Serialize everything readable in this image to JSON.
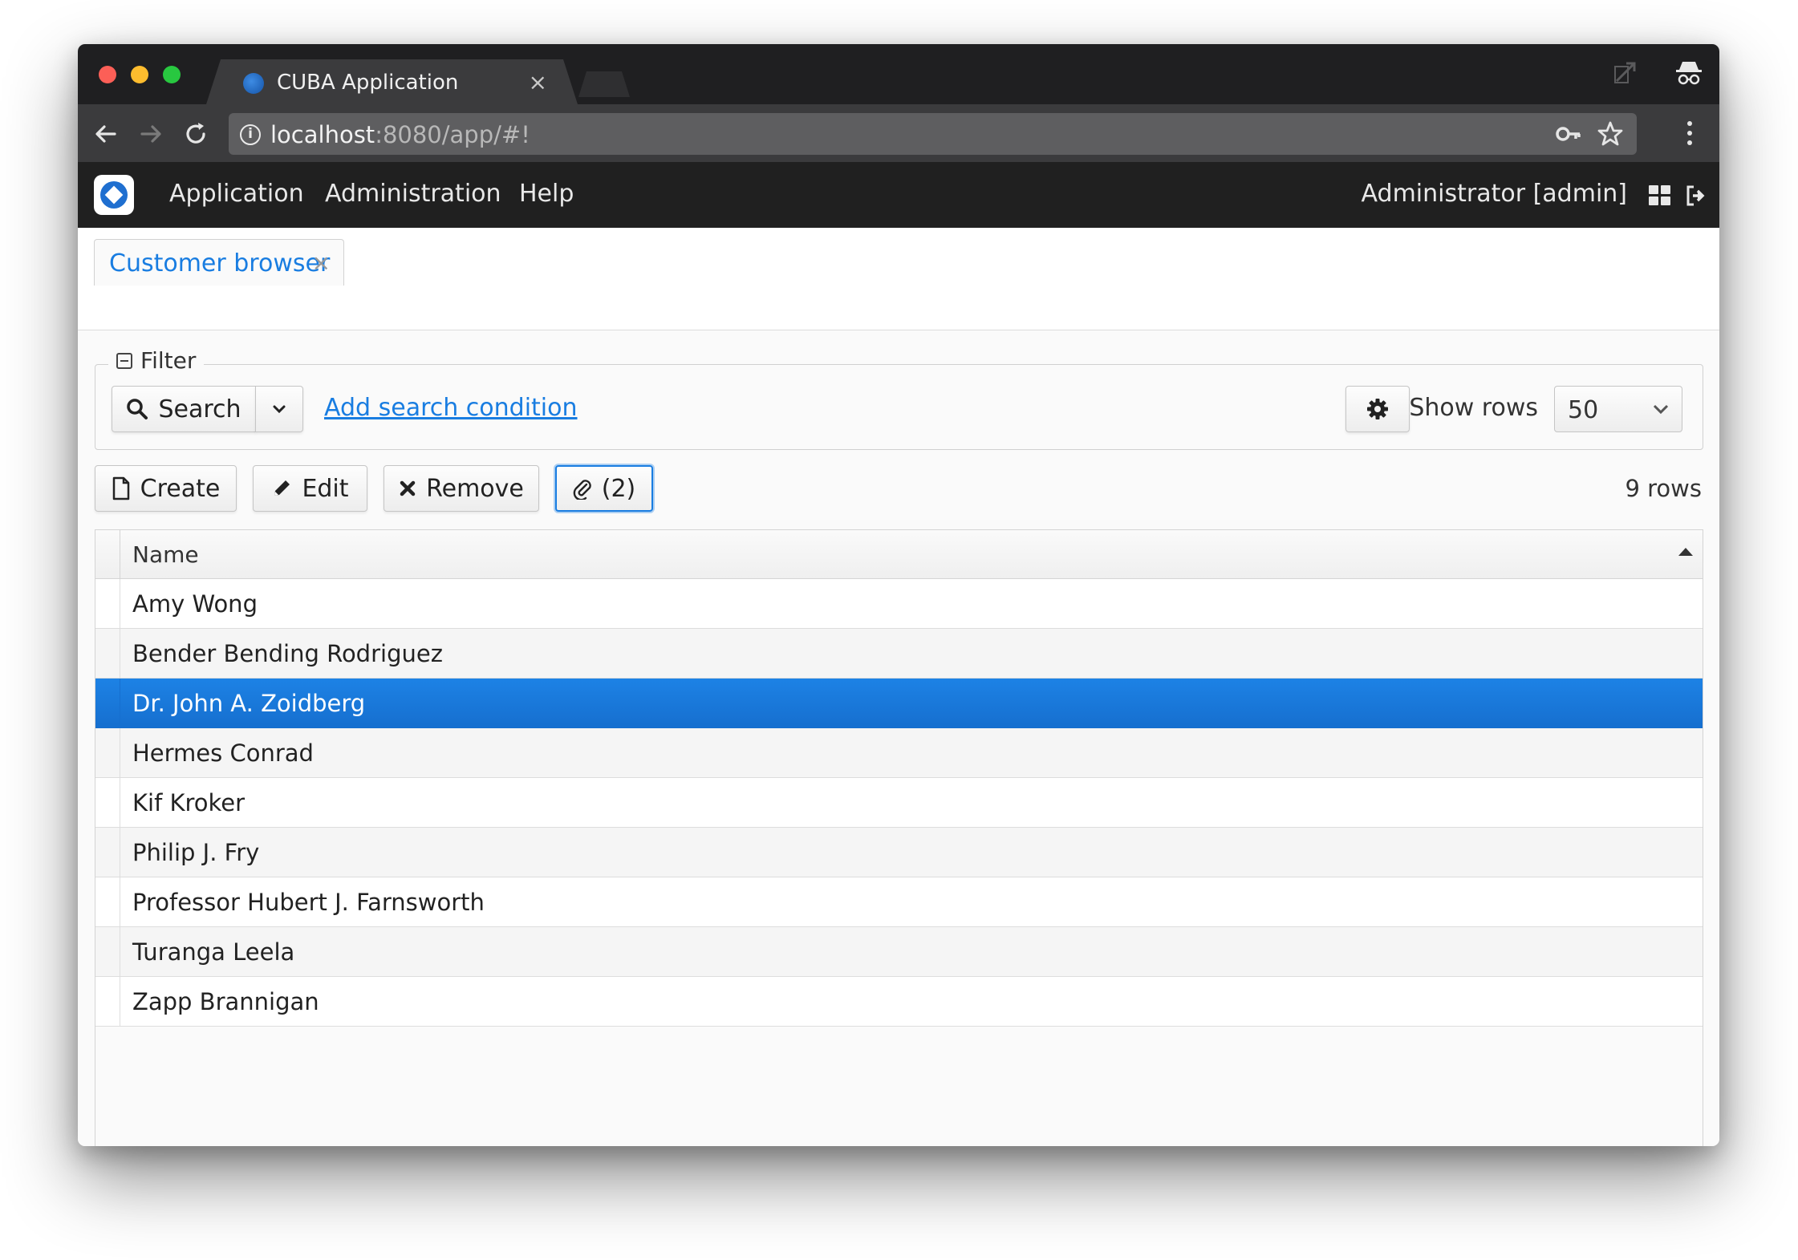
{
  "browser": {
    "tab_title": "CUBA Application",
    "tab_close": "×",
    "url_host": "localhost",
    "url_rest": ":8080/app/#!"
  },
  "app": {
    "menu": [
      "Application",
      "Administration",
      "Help"
    ],
    "user": "Administrator [admin]"
  },
  "screen_tab": {
    "label": "Customer browser",
    "close": "×"
  },
  "filter": {
    "legend": "Filter",
    "search_label": "Search",
    "add_condition": "Add search condition",
    "show_rows_label": "Show rows",
    "show_rows_value": "50"
  },
  "actions": {
    "create": "Create",
    "edit": "Edit",
    "remove": "Remove",
    "attachments": "(2)",
    "rows_count": "9 rows"
  },
  "table": {
    "column_name": "Name",
    "rows": [
      "Amy Wong",
      "Bender Bending Rodriguez",
      "Dr. John A. Zoidberg",
      "Hermes Conrad",
      "Kif Kroker",
      "Philip J. Fry",
      "Professor Hubert J. Farnsworth",
      "Turanga Leela",
      "Zapp Brannigan"
    ],
    "selected_row": "Dr. John A. Zoidberg"
  },
  "colors": {
    "accent": "#197de1",
    "selected_row": "#1d82e5",
    "app_header": "#202020"
  },
  "icons": {
    "search": "search-icon",
    "settings": "gear-icon",
    "create": "file-icon",
    "edit": "pencil-icon",
    "remove": "x-icon",
    "attachment": "paperclip-icon"
  }
}
